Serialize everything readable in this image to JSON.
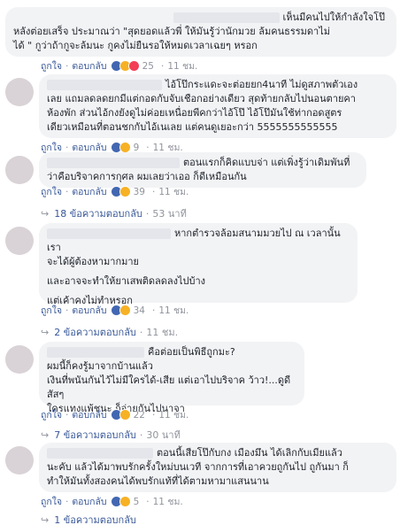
{
  "labels": {
    "like": "ถูกใจ",
    "reply": "ตอบกลับ",
    "sep": "·"
  },
  "colors": {
    "link": "#385898",
    "bubble": "#f2f3f5",
    "meta": "#90949c"
  },
  "comments": [
    {
      "text_lines": [
        "เห็นมีคนไปให้กำลังใจโป๊",
        "หลังต่อยเสร็จ ประมาณว่า \"สุดยอดแล้วพี่ ให้มันรู้ว่านักมวย ล้มคนธรรมดาไม่",
        "ได้ \" กูว่าถ้ากูจะล้มนะ กูคงไม่ยืนรอให้หมดเวลาเฉยๆ หรอก"
      ],
      "reactions": [
        "like-icon",
        "haha-icon",
        "love-icon"
      ],
      "count": "25",
      "time": "11 ชม."
    },
    {
      "text_lines": [
        "ไอ้โป๊กระแดะจะต่อยยก4นาที ไม่ดูสภาพตัวเอง",
        "เลย แถมลดลดยกมีแต่กอดกับจับเชือกอย่างเดียว สุดท้ายกลับไปนอนตายคา",
        "ห้องพัก ส่วนไอ้กงยังดูไม่ค่อยเหนื่อยพีคกว่าไอ้โป๊ ไอ้โป๊มันใช้ท่ากอดสูตร",
        "เดียวเหมือนที่ตอนชกกับไอ้เนเลย แต่คนดูเยอะกว่า 5555555555555"
      ],
      "reactions": [
        "like-icon",
        "haha-icon"
      ],
      "count": "9",
      "time": "11 ชม."
    },
    {
      "text_lines": [
        "ตอนแรกก็คิดแบบจ่า แต่เพิ่งรู้ว่าเดิมพันที่",
        "ว่าคือบริจาคการกุศล ผมเลยว่าเออ ก็ดีเหมือนกัน"
      ],
      "reactions": [
        "like-icon",
        "haha-icon"
      ],
      "count": "39",
      "time": "11 ชม.",
      "replies": {
        "label": "18 ข้อความตอบกลับ",
        "time": "53 นาที"
      }
    },
    {
      "text_lines": [
        "หากตำรวจล้อมสนามมวยไป ณ เวลานั้น เรา",
        "จะได้ผู้ต้องหามากมาย",
        "",
        "และอาจจะทำให้ยาเสพติดลดลงไปบ้าง",
        "",
        "แต่เค้าคงไม่ทำหรอก"
      ],
      "reactions": [
        "like-icon",
        "haha-icon"
      ],
      "count": "34",
      "time": "11 ชม.",
      "replies": {
        "label": "2 ข้อความตอบกลับ",
        "time": "11 ชม."
      }
    },
    {
      "text_lines": [
        "คือต่อยเป็นพิธีถูกมะ?",
        "ผมนี้ก็คงรู้มาจากบ้านแล้ว",
        "เงินที่พนันกันไว้ไม่มีใครได้-เสีย แต่เอาไปบริจาค ว้าว!...ดูดีสัสๆ",
        "ใครแทงแพ้ชนะ ก็จ่ายกันไปนาจา"
      ],
      "reactions": [
        "like-icon",
        "haha-icon"
      ],
      "count": "22",
      "time": "11 ชม.",
      "replies": {
        "label": "7 ข้อความตอบกลับ",
        "time": "30 นาที"
      }
    },
    {
      "text_lines": [
        "ตอนนี้เสียโป๊กับกง เมืองมึน ได้เลิกกับเมียแล้ว",
        "นะคับ แล้วได้มาพบรักครั้งใหม่บนเวที จากการที่เอาควยถูกันไป ถูกันมา ก็",
        "ทำให้มันทั้งสองคนได้พบรักแท้ที่ได้ตามหามาแสนนาน"
      ],
      "reactions": [
        "like-icon",
        "haha-icon"
      ],
      "count": "5",
      "time": "11 ชม.",
      "replies": {
        "label": "1 ข้อความตอบกลับ",
        "time": ""
      }
    }
  ]
}
